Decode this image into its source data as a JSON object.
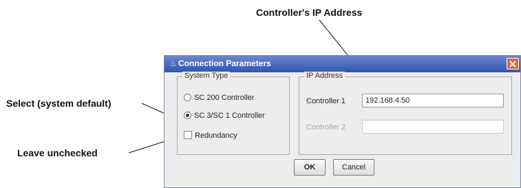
{
  "annotations": {
    "ip_address": "Controller's IP Address",
    "select_default": "Select (system default)",
    "leave_unchecked": "Leave unchecked"
  },
  "dialog": {
    "title": "Connection Parameters",
    "system_type": {
      "legend": "System Type",
      "options": [
        {
          "label": "SC 200 Controller",
          "selected": false
        },
        {
          "label": "SC 3/SC 1 Controller",
          "selected": true
        }
      ],
      "redundancy": {
        "label": "Redundancy",
        "checked": false
      }
    },
    "ip_address": {
      "legend": "IP Address",
      "controller1": {
        "label": "Controller 1",
        "value": "192.168.4.50"
      },
      "controller2": {
        "label": "Controller 2",
        "value": ""
      }
    },
    "buttons": {
      "ok": "OK",
      "cancel": "Cancel"
    }
  },
  "colors": {
    "titlebar": "#2f55b3",
    "close_button": "#e0663c",
    "dialog_bg": "#ededed"
  }
}
